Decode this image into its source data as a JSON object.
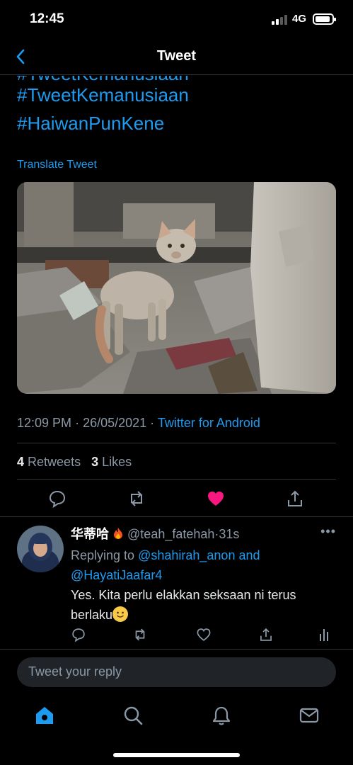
{
  "status_bar": {
    "time": "12:45",
    "network": "4G",
    "battery_level": 0.9
  },
  "nav": {
    "title": "Tweet"
  },
  "tweet": {
    "cut_hashtag": "#TweetKemanusiaan",
    "hashtags": [
      "#TweetKemanusiaan",
      "#HaiwanPunKene"
    ],
    "translate_label": "Translate Tweet",
    "time": "12:09 PM",
    "date": "26/05/2021",
    "source": "Twitter for Android",
    "retweets_count": "4",
    "retweets_label": "Retweets",
    "likes_count": "3",
    "likes_label": "Likes",
    "image_icon": "stray-cat-photo",
    "liked_color": "#f91880"
  },
  "reply": {
    "display_name": "华蒂哈",
    "handle": "@teah_fatehah",
    "age": "31s",
    "replying_to_label": "Replying to",
    "mention_1": "@shahirah_anon",
    "and_label": "and",
    "mention_2": "@HayatiJaafar4",
    "text": "Yes. Kita perlu elakkan seksaan ni terus berlaku"
  },
  "composer": {
    "placeholder": "Tweet your reply"
  },
  "colors": {
    "accent": "#1d9bf0",
    "background": "#000000",
    "secondary_text": "#8b98a5"
  }
}
